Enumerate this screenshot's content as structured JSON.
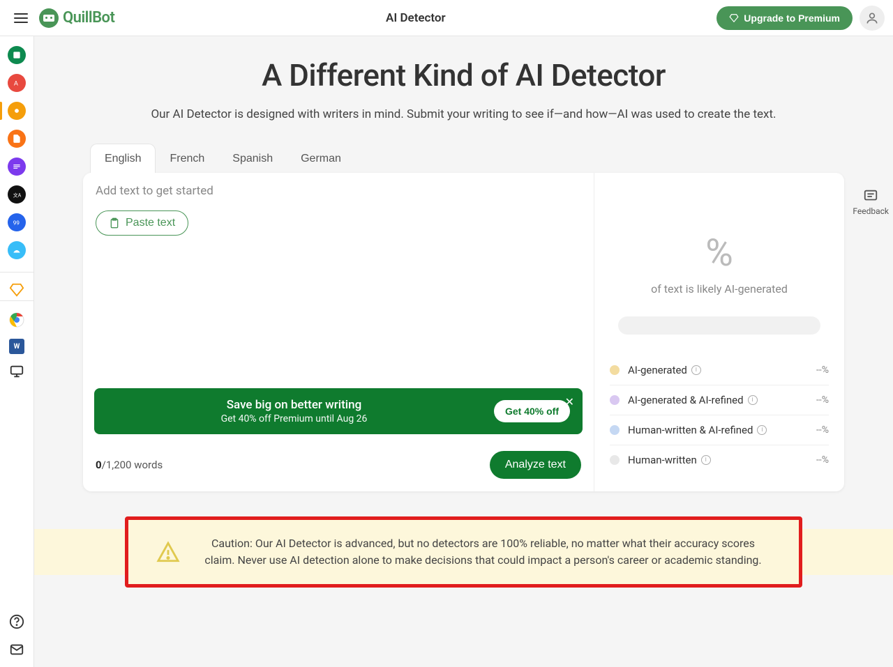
{
  "header": {
    "logo_text": "QuillBot",
    "title": "AI Detector",
    "premium_label": "Upgrade to Premium"
  },
  "feedback_label": "Feedback",
  "main": {
    "title": "A Different Kind of AI Detector",
    "subtitle": "Our AI Detector is designed with writers in mind. Submit your writing to see if—and how—AI was used to create the text."
  },
  "tabs": [
    "English",
    "French",
    "Spanish",
    "German"
  ],
  "editor": {
    "placeholder": "Add text to get started",
    "paste_label": "Paste text"
  },
  "promo": {
    "title": "Save big on better writing",
    "sub": "Get 40% off Premium until Aug 26",
    "cta": "Get 40% off"
  },
  "word_count": {
    "current": "0",
    "sep": "/",
    "max": "1,200",
    "unit": " words"
  },
  "analyze_label": "Analyze text",
  "results": {
    "percent": "%",
    "sub": "of text is likely AI-generated",
    "legend": [
      {
        "label": "AI-generated",
        "value": "--%",
        "color": "#f3dca0"
      },
      {
        "label": "AI-generated & AI-refined",
        "value": "--%",
        "color": "#d9c8f1"
      },
      {
        "label": "Human-written & AI-refined",
        "value": "--%",
        "color": "#c5d8f3"
      },
      {
        "label": "Human-written",
        "value": "--%",
        "color": "#e8e8e8"
      }
    ]
  },
  "caution": "Caution: Our AI Detector is advanced, but no detectors are 100% reliable, no matter what their accuracy scores claim. Never use AI detection alone to make decisions that could impact a person's career or academic standing."
}
